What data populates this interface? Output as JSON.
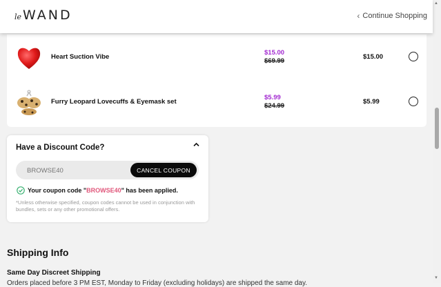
{
  "header": {
    "logo_prefix": "le",
    "logo_text": "WAND",
    "continue_label": "Continue Shopping"
  },
  "cart": {
    "items": [
      {
        "name": "Heart Suction Vibe",
        "sale_price": "$15.00",
        "original_price": "$69.99",
        "total": "$15.00",
        "image_icon": "red-heart-product"
      },
      {
        "name": "Furry Leopard Lovecuffs & Eyemask set",
        "sale_price": "$5.99",
        "original_price": "$24.99",
        "total": "$5.99",
        "image_icon": "leopard-cuffs-product"
      }
    ]
  },
  "discount": {
    "title": "Have a Discount Code?",
    "input_placeholder": "BROWSE40",
    "cancel_label": "CANCEL COUPON",
    "applied_prefix": "Your coupon code \"",
    "applied_code": "BROWSE40",
    "applied_suffix": "\" has been applied.",
    "note": "*Unless otherwise specified, coupon codes cannot be used in conjunction with bundles, sets or any other promotional offers."
  },
  "shipping": {
    "title": "Shipping Info",
    "subtitle": "Same Day Discreet Shipping",
    "body": "Orders placed before 3 PM EST, Monday to Friday (excluding holidays) are shipped the same day."
  },
  "colors": {
    "sale": "#a32bd1",
    "coupon_code": "#e0567a",
    "check": "#3bb273"
  }
}
